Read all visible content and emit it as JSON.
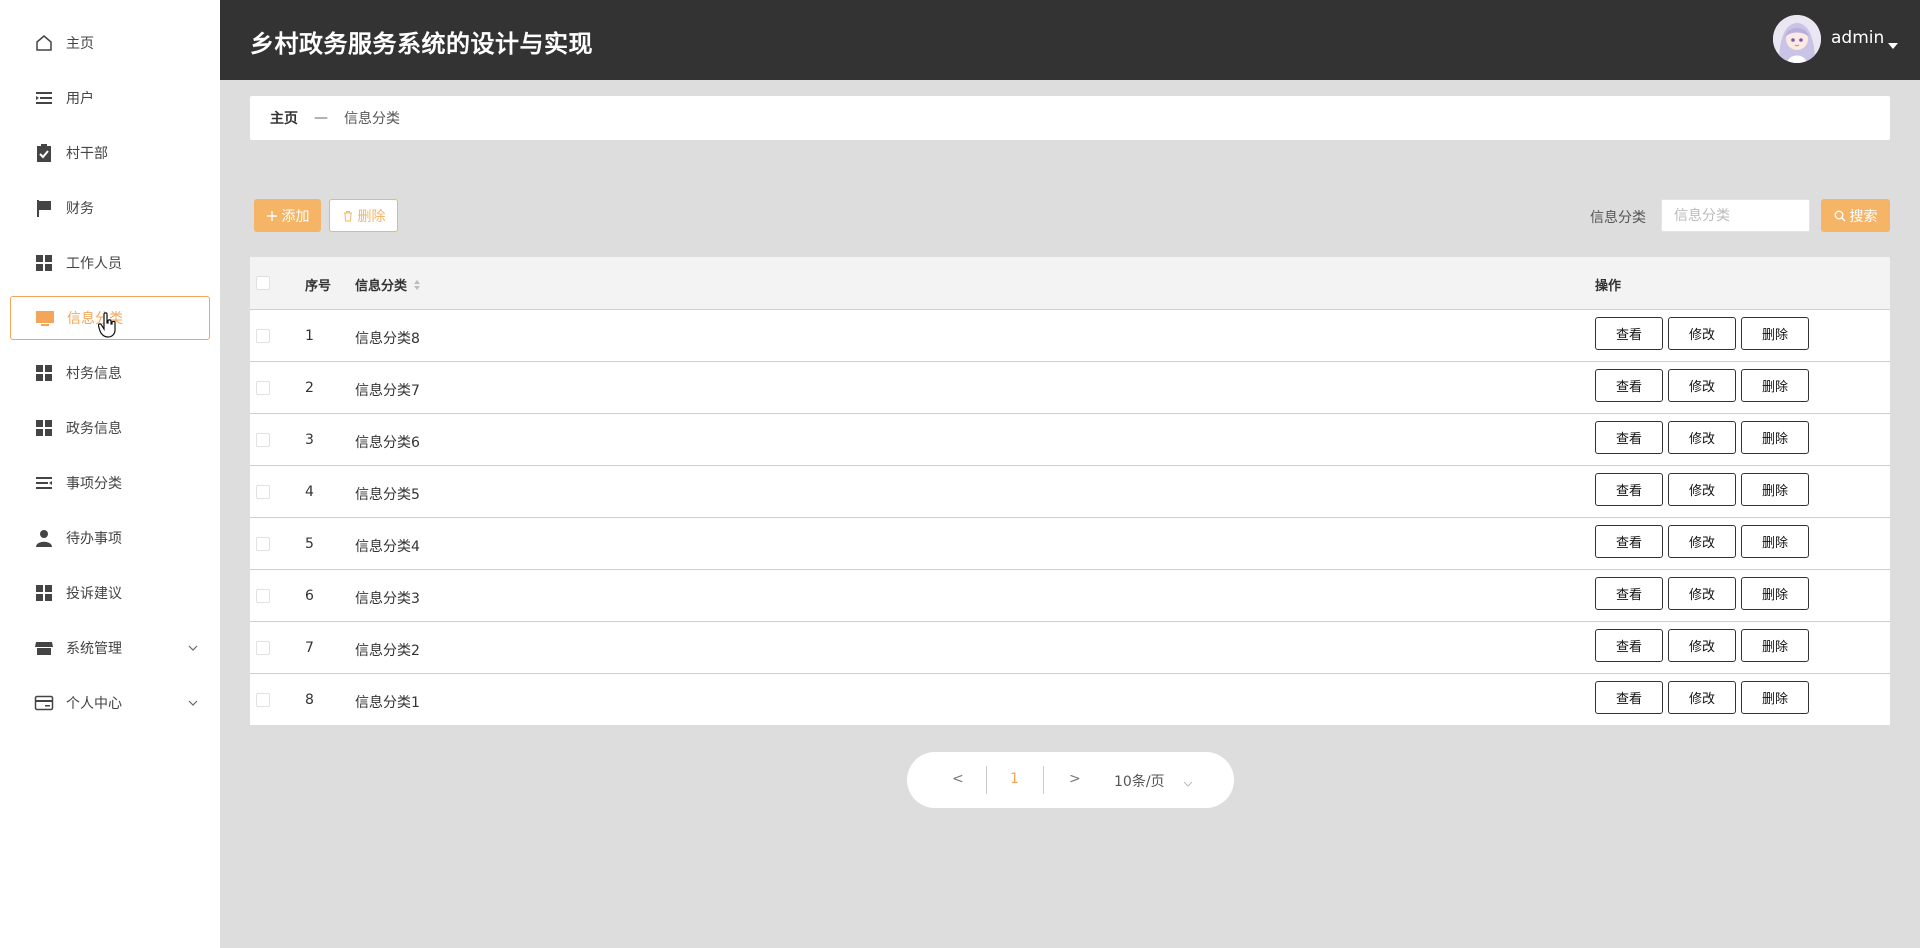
{
  "sidebar": {
    "items": [
      {
        "label": "主页",
        "icon": "home-icon"
      },
      {
        "label": "用户",
        "icon": "list-icon"
      },
      {
        "label": "村干部",
        "icon": "clipboard-check-icon"
      },
      {
        "label": "财务",
        "icon": "flag-icon"
      },
      {
        "label": "工作人员",
        "icon": "grid-icon"
      },
      {
        "label": "信息分类",
        "icon": "monitor-icon",
        "active": true
      },
      {
        "label": "村务信息",
        "icon": "grid-icon"
      },
      {
        "label": "政务信息",
        "icon": "grid-icon"
      },
      {
        "label": "事项分类",
        "icon": "list-icon"
      },
      {
        "label": "待办事项",
        "icon": "user-icon"
      },
      {
        "label": "投诉建议",
        "icon": "grid-icon"
      },
      {
        "label": "系统管理",
        "icon": "store-icon",
        "expandable": true
      },
      {
        "label": "个人中心",
        "icon": "card-icon",
        "expandable": true
      }
    ]
  },
  "header": {
    "title": "乡村政务服务系统的设计与实现",
    "user": "admin"
  },
  "breadcrumb": {
    "home": "主页",
    "separator": "—",
    "current": "信息分类"
  },
  "toolbar": {
    "add_label": "添加",
    "delete_label": "删除",
    "search_label": "信息分类",
    "search_placeholder": "信息分类",
    "search_button": "搜索"
  },
  "table": {
    "headers": {
      "index": "序号",
      "name": "信息分类",
      "ops": "操作"
    },
    "rows": [
      {
        "index": "1",
        "name": "信息分类8"
      },
      {
        "index": "2",
        "name": "信息分类7"
      },
      {
        "index": "3",
        "name": "信息分类6"
      },
      {
        "index": "4",
        "name": "信息分类5"
      },
      {
        "index": "5",
        "name": "信息分类4"
      },
      {
        "index": "6",
        "name": "信息分类3"
      },
      {
        "index": "7",
        "name": "信息分类2"
      },
      {
        "index": "8",
        "name": "信息分类1"
      }
    ],
    "actions": {
      "view": "查看",
      "edit": "修改",
      "remove": "删除"
    }
  },
  "pagination": {
    "prev": "<",
    "page": "1",
    "next": ">",
    "page_size": "10条/页"
  },
  "colors": {
    "accent": "#f5b466",
    "header_bg": "#333333",
    "page_bg": "#dddddd"
  }
}
